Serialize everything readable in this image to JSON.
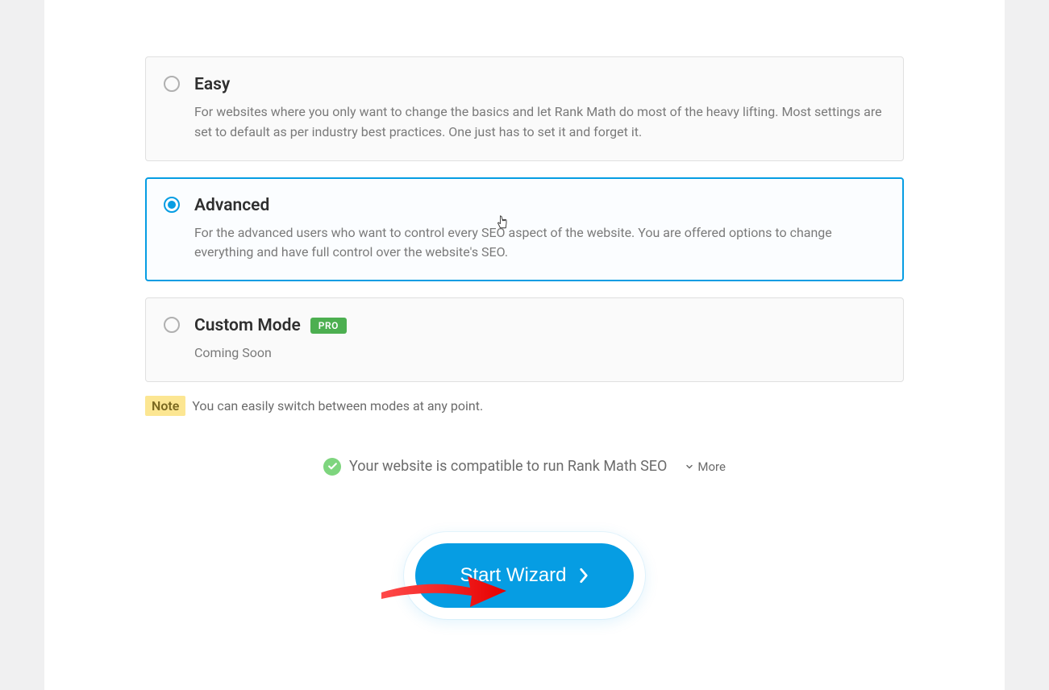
{
  "options": {
    "easy": {
      "title": "Easy",
      "desc": "For websites where you only want to change the basics and let Rank Math do most of the heavy lifting. Most settings are set to default as per industry best practices. One just has to set it and forget it."
    },
    "advanced": {
      "title": "Advanced",
      "desc": "For the advanced users who want to control every SEO aspect of the website. You are offered options to change everything and have full control over the website's SEO."
    },
    "custom": {
      "title": "Custom Mode",
      "badge": "PRO",
      "desc": "Coming Soon"
    }
  },
  "note_label": "Note",
  "note_text": " You can easily switch between modes at any point.",
  "compat_text": "Your website is compatible to run Rank Math SEO",
  "more_label": "More",
  "start_button": "Start Wizard"
}
